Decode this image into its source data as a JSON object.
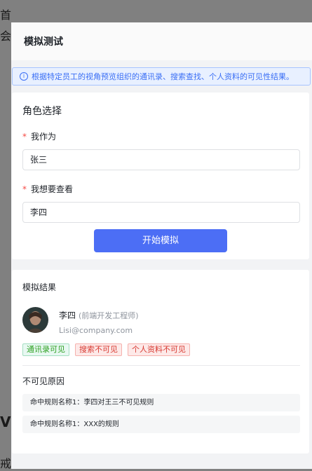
{
  "background": {
    "chars": [
      "首",
      "会",
      "V",
      "戒"
    ]
  },
  "drawer": {
    "title": "模拟测试"
  },
  "alert": {
    "icon": "info-icon",
    "text": "根据特定员工的视角预览组织的通讯录、搜索查找、个人资料的可见性结果。"
  },
  "role_card": {
    "title": "角色选择",
    "required_mark": "*",
    "viewer_label": "我作为",
    "viewer_value": "张三",
    "target_label": "我想要查看",
    "target_value": "李四",
    "start_button": "开始模拟"
  },
  "result_card": {
    "title": "模拟结果",
    "person": {
      "name": "李四",
      "title": "(前端开发工程师)",
      "email": "Lisi@company.com"
    },
    "tags": [
      {
        "label": "通讯录可见",
        "status": "visible"
      },
      {
        "label": "搜索不可见",
        "status": "hidden"
      },
      {
        "label": "个人资料不可见",
        "status": "hidden"
      }
    ],
    "reasons_title": "不可见原因",
    "reasons": [
      "命中规则名称1：李四对王三不可见规则",
      "命中规则名称1：XXX的规则"
    ]
  },
  "colors": {
    "primary": "#4c6ef5",
    "alert_text": "#3b6ff5",
    "visible_green": "#2ea121",
    "hidden_red": "#d83931",
    "required_red": "#f54a45"
  }
}
